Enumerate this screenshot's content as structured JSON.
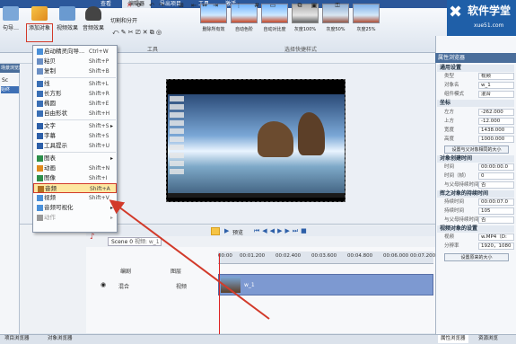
{
  "tabs": [
    "查看",
    "编辑器",
    "导出项目",
    "工具",
    "激活"
  ],
  "active_tab": 1,
  "ribbon": {
    "left_btn": "句导…",
    "add_object": "添加对象",
    "video_effect": "视频效果",
    "audio_effect": "音频效果",
    "cut_split": "切割和分开",
    "tools_group": "工具",
    "quick_style_group": "选择快捷样式",
    "thumbnails": [
      "删除所有效",
      "自动色阶",
      "自动对比度",
      "灰度100%",
      "灰度50%",
      "灰度25%"
    ]
  },
  "logo": {
    "title": "软件学堂",
    "url": "xue51.com"
  },
  "left_panel": {
    "header": "场景浏览器",
    "item_sc": "Sc",
    "item_bg": "始终"
  },
  "menu": [
    {
      "label": "启动精灵向导...",
      "shortcut": "Ctrl+W",
      "icon": "wizard-icon",
      "color": "#4a90d9"
    },
    {
      "label": "粘贝",
      "shortcut": "Shift+P",
      "icon": "paste-icon",
      "color": "#6b8fc4"
    },
    {
      "label": "复制",
      "shortcut": "Shift+B",
      "icon": "copy-icon",
      "color": "#6b8fc4"
    },
    {
      "sep": true
    },
    {
      "label": "线",
      "shortcut": "Shift+L",
      "icon": "line-icon",
      "color": "#3a6fb5"
    },
    {
      "label": "长方形",
      "shortcut": "Shift+R",
      "icon": "rectangle-icon",
      "color": "#3a6fb5"
    },
    {
      "label": "椭圆",
      "shortcut": "Shift+E",
      "icon": "ellipse-icon",
      "color": "#3a6fb5"
    },
    {
      "label": "自由形状",
      "shortcut": "Shift+H",
      "icon": "freeform-icon",
      "color": "#3a6fb5"
    },
    {
      "sep": true
    },
    {
      "label": "文字",
      "shortcut": "Shift+S",
      "icon": "text-icon",
      "color": "#2d5fa8",
      "arrow": true
    },
    {
      "label": "字幕",
      "shortcut": "Shift+S",
      "icon": "subtitle-icon",
      "color": "#2d5fa8"
    },
    {
      "label": "工具提示",
      "shortcut": "Shift+U",
      "icon": "tooltip-icon",
      "color": "#2d5fa8"
    },
    {
      "sep": true
    },
    {
      "label": "图表",
      "shortcut": "",
      "icon": "chart-icon",
      "color": "#2d8f4a",
      "arrow": true
    },
    {
      "label": "动画",
      "shortcut": "Shift+N",
      "icon": "animation-icon",
      "color": "#e08a1e"
    },
    {
      "label": "图像",
      "shortcut": "Shift+I",
      "icon": "image-icon",
      "color": "#2d8f4a"
    },
    {
      "label": "音频",
      "shortcut": "Shift+A",
      "icon": "audio-icon",
      "color": "#b07020",
      "highlight": true
    },
    {
      "label": "视频",
      "shortcut": "Shift+V",
      "icon": "video-icon",
      "color": "#4a90d9"
    },
    {
      "label": "音频可视化",
      "shortcut": "",
      "icon": "visualizer-icon",
      "color": "#4a90d9",
      "arrow": true
    },
    {
      "label": "动作",
      "shortcut": "",
      "icon": "action-icon",
      "color": "#999",
      "arrow": true,
      "disabled": true
    }
  ],
  "right_panel": {
    "header": "属性浏览器",
    "sec_general": "通用设置",
    "rows_general": [
      [
        "类型",
        "视频"
      ],
      [
        "对象名",
        "w_1"
      ],
      [
        "组件模式",
        "混合"
      ]
    ],
    "sec_coords": "坐标",
    "rows_coords": [
      [
        "左方",
        "-262.000"
      ],
      [
        "上方",
        "-12.000"
      ],
      [
        "宽度",
        "1438.000"
      ],
      [
        "高度",
        "1000.000"
      ]
    ],
    "btn_fit": "设置与父对象相同的大小",
    "sec_create": "对象创建时间",
    "rows_create": [
      [
        "时间",
        "00:00:00.0"
      ],
      [
        "时间（帧）",
        "0"
      ],
      [
        "与父母持续时间",
        "否"
      ]
    ],
    "sec_duration": "挥之对象的持续时间",
    "rows_duration": [
      [
        "持续时间",
        "00:00:07.0"
      ],
      [
        "持续时间",
        "105"
      ],
      [
        "与父母持续时间",
        "否"
      ]
    ],
    "sec_video": "视频对象的设置",
    "rows_video": [
      [
        "视频",
        "w.MP4（D:"
      ],
      [
        "分辨率",
        "1920，1080"
      ]
    ],
    "btn_origsize": "设置原来的大小"
  },
  "timeline": {
    "scene_tab": "Scene 0",
    "scene_sub": "视频: w_1",
    "preview": "预览",
    "ruler": [
      "00:00",
      "00:01.200",
      "00:02.400",
      "00:03.600",
      "00:04.800",
      "00:06.000",
      "00:07.200"
    ],
    "mix_label": "混合",
    "layer_label": "图层",
    "video_label": "视频",
    "clip_name": "w_1",
    "edit_label": "编剧"
  },
  "status": {
    "left": "项目浏览器",
    "mid": "对象浏览器",
    "right1": "属性浏览器",
    "right2": "资源浏览"
  }
}
